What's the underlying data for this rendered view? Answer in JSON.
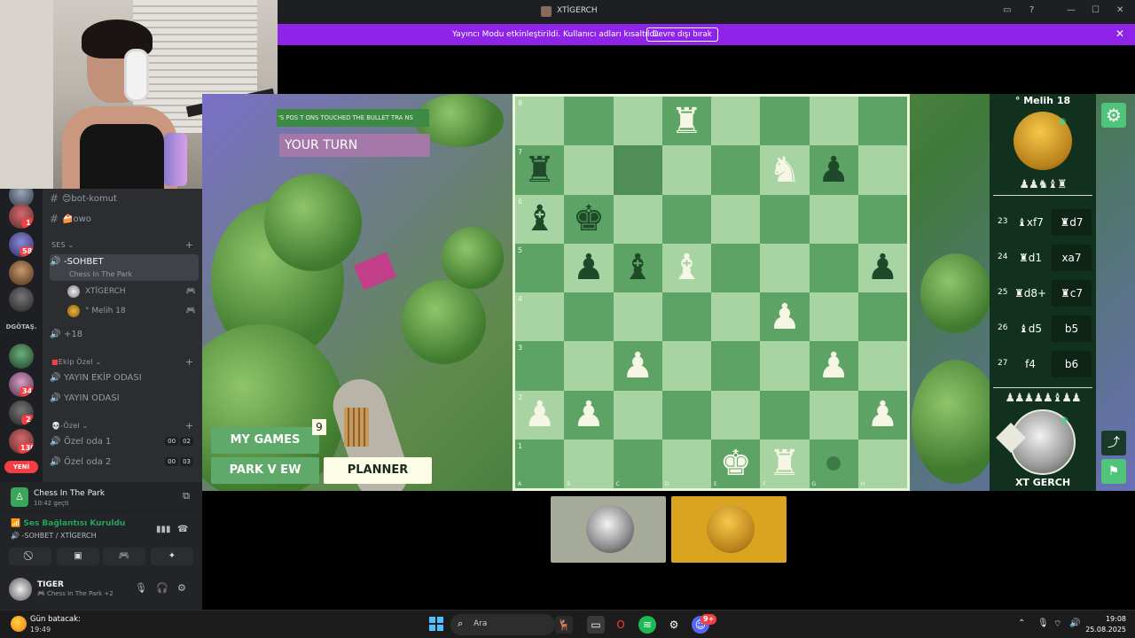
{
  "window": {
    "title": "XTİGERCH"
  },
  "streamer_bar": {
    "message": "Yayıncı Modu etkinleştirildi. Kullanıcı adları kısaltıldı.",
    "button": "Devre dışı bırak"
  },
  "rail": {
    "badges": [
      "1",
      "58",
      "34",
      "2",
      "130"
    ],
    "folder_label": "DGÖTAŞ.",
    "new_label": "YENİ"
  },
  "channels": {
    "text": [
      "😊bot-komut",
      "🍰owo"
    ],
    "voice_category": "SES",
    "active_channel": "-SOHBET",
    "active_activity": "Chess In The Park",
    "members": [
      "XTİGERCH",
      "° Melih 18"
    ],
    "overflow": "+18",
    "category2": "Ekip Özel",
    "ekip_channels": [
      "YAYIN EKİP ODASI",
      "YAYIN ODASI"
    ],
    "category3": "-Özel",
    "ozel_channels": [
      {
        "name": "Özel oda 1",
        "a": "00",
        "b": "02"
      },
      {
        "name": "Özel oda 2",
        "a": "00",
        "b": "03"
      }
    ]
  },
  "activity": {
    "title": "Chess In The Park",
    "subtitle": "10:42 geçti"
  },
  "voice": {
    "status": "Ses Bağlantısı Kuruldu",
    "location": "-SOHBET / XTİGERCH"
  },
  "user": {
    "name": "TIGER",
    "status": "Chess In The Park +2"
  },
  "game": {
    "notice": "'S POS T ONS TOUCHED THE BULLET TRA NS",
    "turn": "YOUR TURN",
    "my_games": "MY GAMES",
    "my_games_count": "9",
    "park_view": "PARK V EW",
    "planner": "PLANNER"
  },
  "board": {
    "files": [
      "A",
      "B",
      "C",
      "D",
      "E",
      "F",
      "G",
      "H"
    ],
    "ranks": [
      "8",
      "7",
      "6",
      "5",
      "4",
      "3",
      "2",
      "1"
    ],
    "pieces": [
      {
        "square": "d8",
        "glyph": "♜",
        "color": "white"
      },
      {
        "square": "a7",
        "glyph": "♜",
        "color": "black"
      },
      {
        "square": "f7",
        "glyph": "♞",
        "color": "white"
      },
      {
        "square": "g7",
        "glyph": "♟",
        "color": "black"
      },
      {
        "square": "a6",
        "glyph": "♝",
        "color": "black"
      },
      {
        "square": "b6",
        "glyph": "♚",
        "color": "black"
      },
      {
        "square": "b5",
        "glyph": "♟",
        "color": "black"
      },
      {
        "square": "c5",
        "glyph": "♝",
        "color": "black"
      },
      {
        "square": "d5",
        "glyph": "♝",
        "color": "white"
      },
      {
        "square": "h5",
        "glyph": "♟",
        "color": "black"
      },
      {
        "square": "f4",
        "glyph": "♟",
        "color": "white"
      },
      {
        "square": "c3",
        "glyph": "♟",
        "color": "white"
      },
      {
        "square": "g3",
        "glyph": "♟",
        "color": "white"
      },
      {
        "square": "a2",
        "glyph": "♟",
        "color": "white"
      },
      {
        "square": "b2",
        "glyph": "♟",
        "color": "white"
      },
      {
        "square": "h2",
        "glyph": "♟",
        "color": "white"
      },
      {
        "square": "e1",
        "glyph": "♚",
        "color": "white"
      },
      {
        "square": "f1",
        "glyph": "♜",
        "color": "white"
      }
    ],
    "highlight": "c7",
    "move_dot": "g1",
    "colors": {
      "light": "#a8d4a3",
      "dark": "#5da366",
      "frame": "#e8f5d8"
    }
  },
  "moves_panel": {
    "opponent": "° Melih 18",
    "captured_top": "♟♟♞♝♜",
    "captured_bottom": "♟♟♟♟♟♝♟♟",
    "player": "XT GERCH",
    "moves": [
      {
        "no": "23",
        "white": "♝xf7",
        "black": "♜d7"
      },
      {
        "no": "24",
        "white": "♜d1",
        "black": "xa7"
      },
      {
        "no": "25",
        "white": "♜d8+",
        "black": "♜c7"
      },
      {
        "no": "26",
        "white": "♝d5",
        "black": "b5"
      },
      {
        "no": "27",
        "white": "f4",
        "black": "b6"
      }
    ]
  },
  "taskbar": {
    "weather_title": "Gün batacak:",
    "weather_time": "19:49",
    "search": "Ara",
    "discord_badge": "9+",
    "time": "19:08",
    "date": "25.08.2025"
  }
}
